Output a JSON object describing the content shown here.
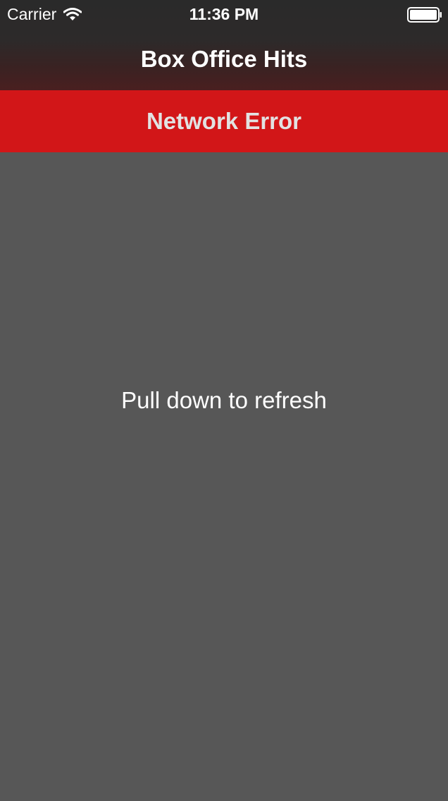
{
  "status_bar": {
    "carrier": "Carrier",
    "time": "11:36 PM",
    "wifi_icon": "wifi-icon",
    "battery_icon": "battery-icon"
  },
  "nav_bar": {
    "title": "Box Office Hits"
  },
  "error_banner": {
    "message": "Network Error",
    "color": "#d21618"
  },
  "content": {
    "empty_message": "Pull down to refresh",
    "background": "#575757"
  }
}
